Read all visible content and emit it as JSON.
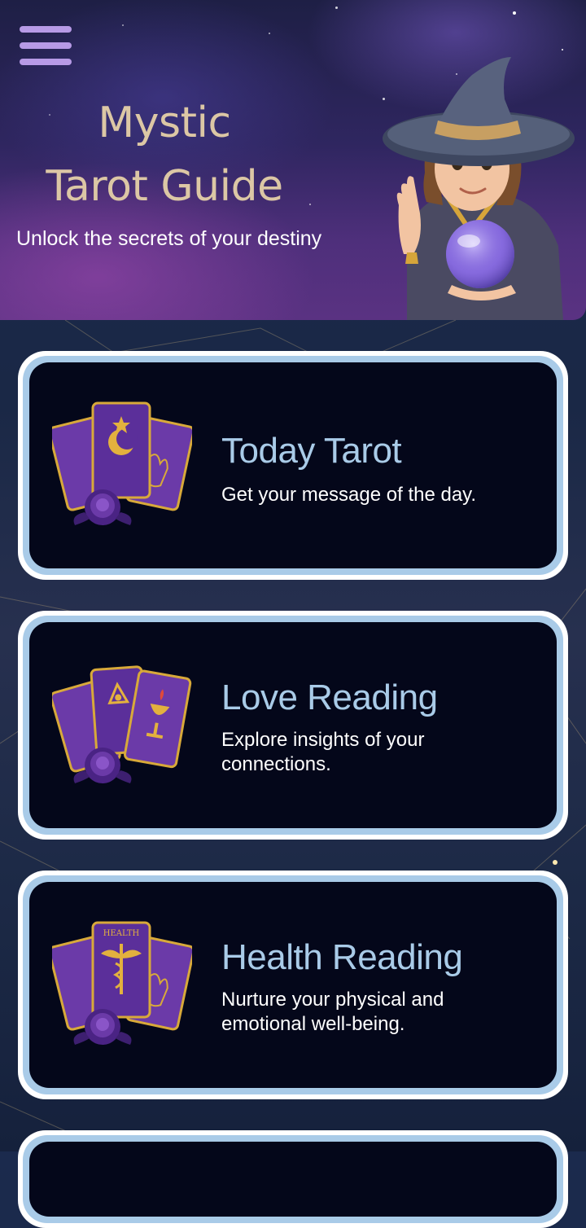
{
  "header": {
    "title_line1": "Mystic",
    "title_line2": "Tarot Guide",
    "tagline": "Unlock the secrets of your destiny"
  },
  "cards": [
    {
      "title": "Today Tarot",
      "description": "Get your message of the day."
    },
    {
      "title": "Love Reading",
      "description": "Explore insights of your connections."
    },
    {
      "title": "Health Reading",
      "description": "Nurture your physical and emotional well-being.",
      "card_label": "HEALTH"
    }
  ],
  "icons": {
    "menu": "hamburger-menu-icon",
    "mascot": "wizard-with-crystal-ball",
    "card_art": "tarot-cards-with-purple-rose"
  },
  "colors": {
    "title_gold": "#dcc7a5",
    "card_title_blue": "#a9cbe8",
    "card_border": "#a9cbe8",
    "card_background": "#04071a",
    "menu_purple": "#b79ae6",
    "card_purple": "#6b3aa8",
    "card_gold": "#d8a93a"
  }
}
